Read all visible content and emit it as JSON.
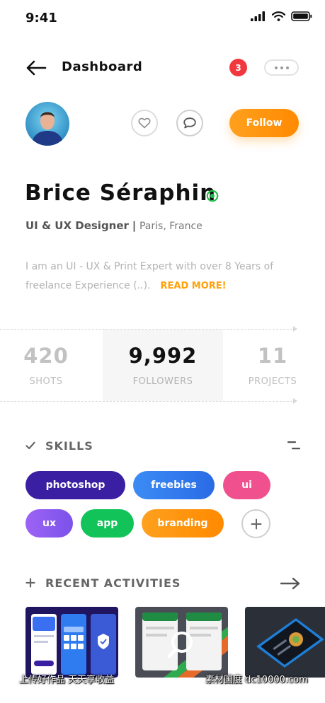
{
  "status_bar": {
    "time": "9:41"
  },
  "header": {
    "title": "Dashboard",
    "notification_count": "3"
  },
  "profile": {
    "follow_label": "Follow",
    "name": "Brice Séraphin",
    "role": "UI & UX Designer",
    "separator": "|",
    "location": "Paris, France",
    "bio": "I am an UI - UX & Print Expert with over 8 Years of freelance Experience (..).",
    "read_more": "READ MORE!"
  },
  "stats": [
    {
      "value": "420",
      "label": "SHOTS"
    },
    {
      "value": "9,992",
      "label": "FOLLOWERS"
    },
    {
      "value": "11",
      "label": "PROJECTS"
    }
  ],
  "skills": {
    "title": "SKILLS",
    "chips": [
      {
        "label": "photoshop",
        "color": "#3a1fa3"
      },
      {
        "label": "freebies",
        "color": "#2f7bf0"
      },
      {
        "label": "ui",
        "color": "#f0508e"
      },
      {
        "label": "ux",
        "color": "#8d5cf0"
      },
      {
        "label": "app",
        "color": "#12c35a"
      },
      {
        "label": "branding",
        "color": "#ff940e"
      }
    ]
  },
  "recent": {
    "title": "RECENT ACTIVITIES"
  },
  "watermark": {
    "left": "上传好作品 天天享收益",
    "right": "素材国度 dc10000.com"
  },
  "colors": {
    "accent": "#ff9a12",
    "badge": "#f0383e",
    "verified": "#1fbf4a"
  },
  "icons": [
    "signal-icon",
    "wifi-icon",
    "battery-icon",
    "back-arrow-icon",
    "more-dots-icon",
    "heart-icon",
    "chat-bubble-icon",
    "verified-icon",
    "check-icon",
    "filter-icon",
    "plus-icon",
    "arrow-right-icon",
    "search-icon"
  ]
}
